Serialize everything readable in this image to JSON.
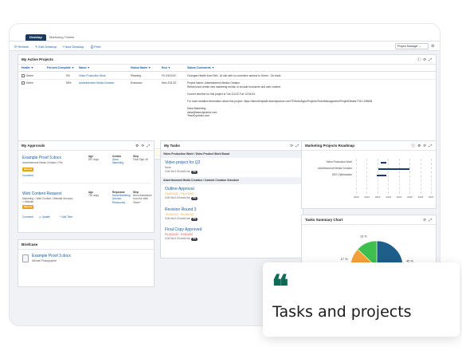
{
  "tabs": {
    "desktop": "Desktop",
    "tickets": "Marketing Tickets"
  },
  "toolbar": {
    "refresh": "Refresh",
    "edit": "Edit Desktop",
    "new": "New Desktop",
    "print": "Print",
    "selector": "Project Manager ⌄"
  },
  "active_projects": {
    "title": "My Active Projects",
    "icons": "ⓘ ⟳ ⤢",
    "columns": {
      "health": "Health ▼",
      "percent": "Percent Complete ▼",
      "name": "Name ▼",
      "status": "Status Name ▼",
      "end": "End ▼",
      "comments": "Status Comments ▼"
    },
    "rows": [
      {
        "health": "Green",
        "percent": "0%",
        "name": "Video Production Work",
        "status": "Planning",
        "end": "Fri 10/21/22",
        "comment": "Changed Health from Red - At risk with no corrective actions to Green - On track."
      },
      {
        "health": "Green",
        "percent": "50%",
        "name": "Advertisement Media Creation",
        "status": "Execution",
        "end": "Mon 2/21/22",
        "comment_lines": [
          "Project Name: Advertisement Media Creation",
          "Refresh and create new marketing media, to include brochures and web content.",
          "",
          "Current timeline for this project is Tue 2/1/22-Tue 12/31/24.",
          "",
          "For more detailed information about this project: https://demotemplate.teamdynamix.com/TDNext/Apps/Projects/TeamManagement/ProjectDetails?TID=108628",
          "",
          "Dana Marketing",
          "dana@teamdynamix.com",
          "TeamDynamix.com"
        ]
      },
      {
        "health": "Yellow",
        "percent": "90%",
        "name": "SEO Optimization",
        "status": "Execution",
        "end": "Tue 10/11/22",
        "comment": "Changed Health from Green - On track to Yellow - At risk with corrective actions."
      }
    ]
  },
  "approvals": {
    "title": "My Approvals",
    "icons": "⚙ ⟳ ⤢",
    "items": [
      {
        "title": "Example Proof 3.docx",
        "sub": "Advertisement Media Creation / File",
        "badge": "Manual",
        "action": "Comment",
        "age_label": "Age",
        "age": "897 days",
        "creator_label": "Creator",
        "creator": "Dana Marketing",
        "step_label": "Step",
        "step": "Final Sign off"
      },
      {
        "title": "Web Content Request",
        "sub": "Marketing > Web Content / Website Services",
        "sub2": "> Website",
        "badge": "Manual",
        "action": "Comment",
        "action2": "Update",
        "action3": "+ Add Time",
        "age_label": "Age",
        "age": "790 days",
        "creator_label": "Requestor",
        "creator": "Dana Marketing (Human Resources)",
        "step_label": "Step",
        "step": "Need Assistance from the Web Team?"
      }
    ]
  },
  "briefcase": {
    "title": "Briefcase",
    "file": "Example Proof 3.docx",
    "owner": "Michael Photographer"
  },
  "tasks": {
    "title": "My Tasks",
    "icons": "⟳ ⤢",
    "group1": "Video Production Work / Video Product Work Board",
    "group2": "Advertisement Media Creation / Content Creation Schedule",
    "items": [
      {
        "title": "Video project for Q2",
        "date": "None",
        "hours": "0.00 hrs ",
        "of": "0.00 est'd hrs",
        "pct": "0%"
      },
      {
        "title": "Outline Approval",
        "date": "Thu 6/23/22 - Thu 6/23/22",
        "hours": "0.00 hrs ",
        "of": "0.00 est'd hrs",
        "pct": "0%"
      },
      {
        "title": "Revision Round 3",
        "date": "Thu 8/11/22 - Thu 8/11/22",
        "hours": "0.00 hrs ",
        "of": "0.00 est'd hrs",
        "pct": "0%"
      },
      {
        "title": "Final Copy Approved",
        "date": "Fri 10/21/22 - Fri 8/12/22",
        "hours": "0.00 hrs ",
        "of": "0.00 est'd hrs",
        "pct": "0%"
      }
    ]
  },
  "roadmap": {
    "title": "Marketing Projects Roadmap",
    "icons": "ⓘ ⚙ ⟳ ⤢",
    "projects": [
      {
        "name": "Video Production Work",
        "start": 2022.3,
        "end": 2022.85
      },
      {
        "name": "Advertisement Media Creation",
        "start": 2022.1,
        "end": 2025.0
      },
      {
        "name": "SEO Optimization",
        "start": 2021.9,
        "end": 2022.8
      }
    ],
    "years": [
      "2020",
      "2021",
      "2022",
      "2023",
      "2024",
      "2025",
      "2026",
      "2027"
    ]
  },
  "tasks_chart": {
    "title": "Tasks Summary Chart",
    "icons": "⟳ ⤢"
  },
  "chart_data": {
    "type": "pie",
    "title": "Tasks Summary Chart",
    "slices": [
      {
        "label": "45 %",
        "value": 45,
        "color": "#1d5f8a"
      },
      {
        "label": "25 %",
        "value": 25,
        "color": "#4a8fe0"
      },
      {
        "label": "17 %",
        "value": 17,
        "color": "#f5a13a"
      },
      {
        "label": "13 %",
        "value": 13,
        "color": "#3fbf4e"
      }
    ]
  },
  "callout": {
    "quote": "❝",
    "text": "Tasks and projects"
  }
}
